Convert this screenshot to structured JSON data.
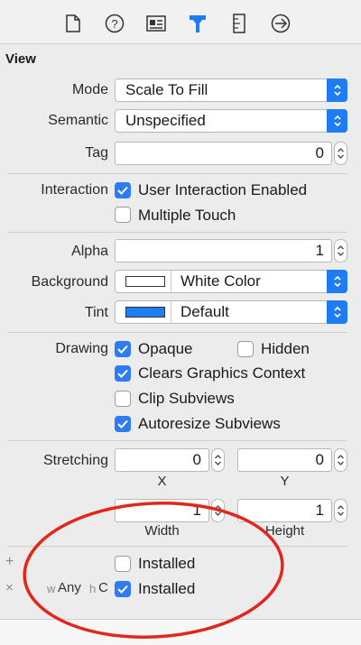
{
  "toolbar": {
    "icons": [
      "file-inspector-icon",
      "quick-help-icon",
      "identity-inspector-icon",
      "attributes-inspector-icon",
      "size-inspector-icon",
      "connections-inspector-icon"
    ],
    "active_icon": "attributes-inspector-icon",
    "accent": "#1e7cf5"
  },
  "view": {
    "title": "View",
    "mode": {
      "label": "Mode",
      "value": "Scale To Fill"
    },
    "semantic": {
      "label": "Semantic",
      "value": "Unspecified"
    },
    "tag": {
      "label": "Tag",
      "value": "0"
    },
    "interaction": {
      "label": "Interaction",
      "user_interaction": {
        "label": "User Interaction Enabled",
        "checked": true
      },
      "multiple_touch": {
        "label": "Multiple Touch",
        "checked": false
      }
    },
    "alpha": {
      "label": "Alpha",
      "value": "1"
    },
    "background": {
      "label": "Background",
      "value": "White Color",
      "swatch": "#ffffff"
    },
    "tint": {
      "label": "Tint",
      "value": "Default",
      "swatch": "#1e7cf5"
    },
    "drawing": {
      "label": "Drawing",
      "opaque": {
        "label": "Opaque",
        "checked": true
      },
      "hidden": {
        "label": "Hidden",
        "checked": false
      },
      "clears_graphics": {
        "label": "Clears Graphics Context",
        "checked": true
      },
      "clip_subviews": {
        "label": "Clip Subviews",
        "checked": false
      },
      "autoresize": {
        "label": "Autoresize Subviews",
        "checked": true
      }
    },
    "stretching": {
      "label": "Stretching",
      "x": "0",
      "y": "0",
      "width": "1",
      "height": "1",
      "x_label": "X",
      "y_label": "Y",
      "width_label": "Width",
      "height_label": "Height"
    },
    "installed": {
      "add_symbol": "+",
      "remove_symbol": "×",
      "base": {
        "label": "Installed",
        "checked": false
      },
      "variation": {
        "w_prefix": "w",
        "w_value": "Any",
        "h_prefix": "h",
        "h_value": "C",
        "label": "Installed",
        "checked": true
      }
    }
  },
  "annotation": {
    "color": "#e3261d"
  }
}
